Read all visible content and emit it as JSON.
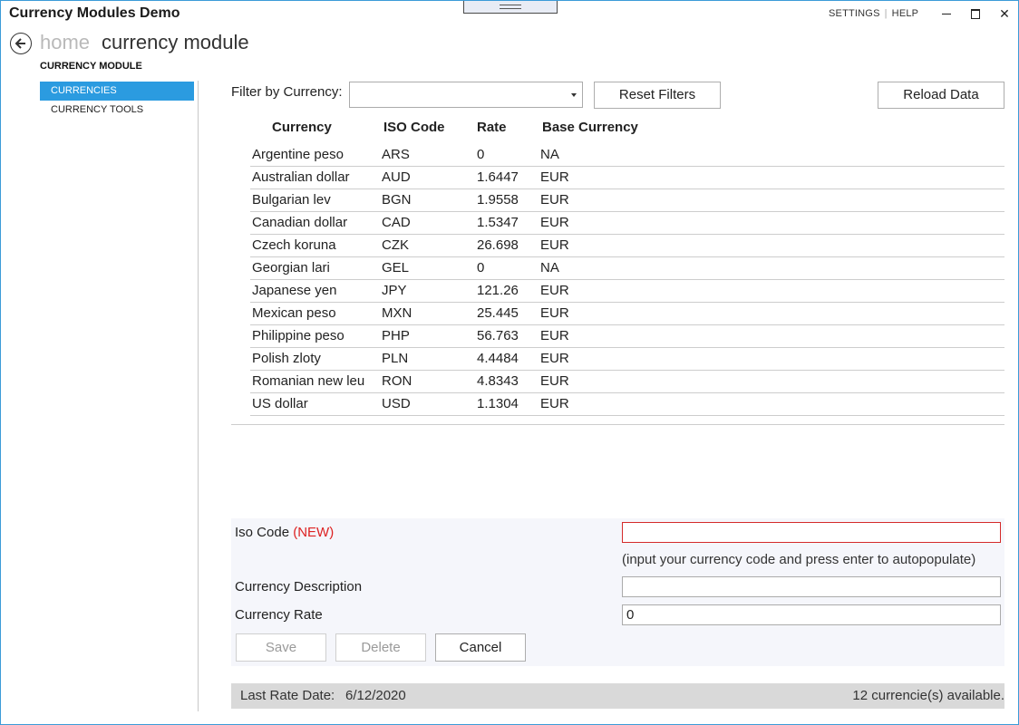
{
  "app": {
    "title": "Currency Modules Demo",
    "settings_label": "SETTINGS",
    "help_label": "HELP"
  },
  "header": {
    "home_label": "home",
    "current_label": "currency module",
    "module_label": "CURRENCY MODULE"
  },
  "sidebar": {
    "items": [
      {
        "label": "CURRENCIES",
        "active": true
      },
      {
        "label": "CURRENCY TOOLS",
        "active": false
      }
    ]
  },
  "filter": {
    "label": "Filter by Currency:",
    "selected": "",
    "reset_label": "Reset Filters",
    "reload_label": "Reload Data"
  },
  "grid": {
    "headers": {
      "currency": "Currency",
      "iso": "ISO Code",
      "rate": "Rate",
      "base": "Base Currency"
    },
    "rows": [
      {
        "currency": "Argentine peso",
        "iso": "ARS",
        "rate": "0",
        "base": "NA"
      },
      {
        "currency": "Australian dollar",
        "iso": "AUD",
        "rate": "1.6447",
        "base": "EUR"
      },
      {
        "currency": "Bulgarian lev",
        "iso": "BGN",
        "rate": "1.9558",
        "base": "EUR"
      },
      {
        "currency": "Canadian dollar",
        "iso": "CAD",
        "rate": "1.5347",
        "base": "EUR"
      },
      {
        "currency": "Czech koruna",
        "iso": "CZK",
        "rate": "26.698",
        "base": "EUR"
      },
      {
        "currency": "Georgian lari",
        "iso": "GEL",
        "rate": "0",
        "base": "NA"
      },
      {
        "currency": "Japanese yen",
        "iso": "JPY",
        "rate": "121.26",
        "base": "EUR"
      },
      {
        "currency": "Mexican peso",
        "iso": "MXN",
        "rate": "25.445",
        "base": "EUR"
      },
      {
        "currency": "Philippine peso",
        "iso": "PHP",
        "rate": "56.763",
        "base": "EUR"
      },
      {
        "currency": "Polish zloty",
        "iso": "PLN",
        "rate": "4.4484",
        "base": "EUR"
      },
      {
        "currency": "Romanian new leu",
        "iso": "RON",
        "rate": "4.8343",
        "base": "EUR"
      },
      {
        "currency": "US dollar",
        "iso": "USD",
        "rate": "1.1304",
        "base": "EUR"
      }
    ]
  },
  "form": {
    "iso_label": "Iso Code",
    "iso_new_tag": "(NEW)",
    "iso_value": "",
    "hint": "(input your currency code and press enter to autopopulate)",
    "description_label": "Currency Description",
    "description_value": "",
    "rate_label": "Currency Rate",
    "rate_value": "0",
    "save_label": "Save",
    "delete_label": "Delete",
    "cancel_label": "Cancel"
  },
  "status": {
    "last_rate_label": "Last Rate Date:",
    "last_rate_date": "6/12/2020",
    "count_text": "12 currencie(s) available."
  },
  "colors": {
    "accent": "#2b9be0",
    "error": "#d42a2a",
    "status_bg": "#d9d9d9"
  }
}
